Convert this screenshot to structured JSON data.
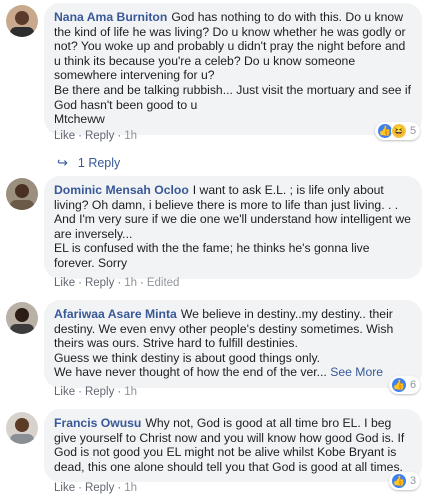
{
  "actions": {
    "like": "Like",
    "reply": "Reply",
    "dot": "·",
    "edited": "Edited",
    "see_more": "See More"
  },
  "colors": {
    "link": "#385898",
    "bubble": "#f2f3f5",
    "like_blue": "#3b82f6"
  },
  "comments": [
    {
      "author": "Nana Ama Burniton",
      "text": "God has nothing to do with this. Do u know the kind of life he was living? Do u know whether he was godly or not? You woke up and probably u didn't pray the night before and u think its because you're a celeb? Do u know someone somewhere intervening for u?\nBe there and be talking rubbish... Just visit the mortuary and see if God hasn't been good to u\nMtcheww",
      "time": "1h",
      "reactions": {
        "icons": [
          "like-icon",
          "haha-icon"
        ],
        "count": "5"
      },
      "replies": "1 Reply"
    },
    {
      "author": "Dominic Mensah Ocloo",
      "text": "I want to ask E.L. ; is life only about living? Oh damn, i believe there is more to life than just living. . . And I'm very sure if we die one we'll understand how intelligent we are inversely...\nEL is confused with the the fame; he thinks he's gonna live forever. Sorry",
      "time": "1h",
      "edited": true
    },
    {
      "author": "Afariwaa Asare Minta",
      "text": "We believe in destiny..my destiny.. their destiny. We even envy other people's destiny sometimes. Wish theirs was ours. Strive hard to fulfill destinies.\nGuess we think destiny is about good things only.\nWe have never thought of how the end of the ver...",
      "time": "1h",
      "reactions": {
        "icons": [
          "like-icon"
        ],
        "count": "6"
      }
    },
    {
      "author": "Francis Owusu",
      "text": "Why not, God is good at all time bro EL. I beg give yourself to Christ now and you will know how good God is. If God is not good you EL might not be alive whilst Kobe Bryant is dead, this one alone should tell you that God is good at all times.",
      "time": "1h",
      "reactions": {
        "icons": [
          "like-icon"
        ],
        "count": "3"
      }
    }
  ]
}
